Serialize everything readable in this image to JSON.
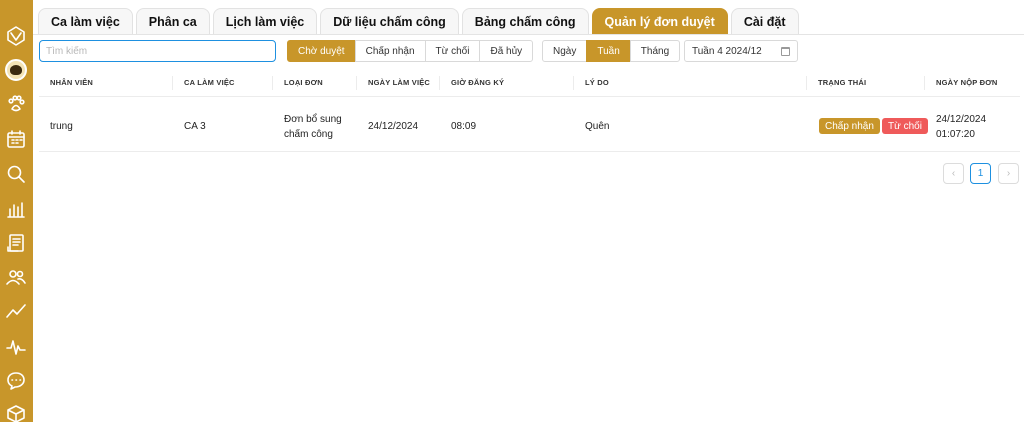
{
  "sidebar": {
    "icons": [
      "logo-icon",
      "paw-icon",
      "calendar-icon",
      "search-icon",
      "bar-chart-icon",
      "document-icon",
      "users-icon",
      "trend-icon",
      "pulse-icon",
      "chat-icon",
      "box-icon"
    ]
  },
  "tabs": [
    {
      "label": "Ca làm việc"
    },
    {
      "label": "Phân ca"
    },
    {
      "label": "Lịch làm việc"
    },
    {
      "label": "Dữ liệu chấm công"
    },
    {
      "label": "Bảng chấm công"
    },
    {
      "label": "Quản lý đơn duyệt",
      "active": true
    },
    {
      "label": "Cài đặt"
    }
  ],
  "search": {
    "placeholder": "Tìm kiếm",
    "value": ""
  },
  "status_filter": [
    "Chờ duyệt",
    "Chấp nhận",
    "Từ chối",
    "Đã hủy"
  ],
  "status_filter_active": "Chờ duyệt",
  "period_filter": [
    "Ngày",
    "Tuần",
    "Tháng"
  ],
  "period_filter_active": "Tuần",
  "week_picker": {
    "value": "Tuần 4 2024/12"
  },
  "table": {
    "columns": [
      "NHÂN VIÊN",
      "CA LÀM VIỆC",
      "LOẠI ĐƠN",
      "NGÀY LÀM VIỆC",
      "GIỜ ĐĂNG KÝ",
      "LÝ DO",
      "TRẠNG THÁI",
      "NGÀY NỘP ĐƠN"
    ],
    "rows": [
      {
        "employee": "trung",
        "shift": "CA 3",
        "type": "Đơn bổ sung chấm công",
        "work_date": "24/12/2024",
        "reg_time": "08:09",
        "reason": "Quên",
        "accept_label": "Chấp nhận",
        "reject_label": "Từ chối",
        "submitted": "24/12/2024 01:07:20"
      }
    ]
  },
  "pagination": {
    "prev": "‹",
    "current": "1",
    "next": "›"
  },
  "colors": {
    "accent": "#c8962a",
    "reject": "#ef5a5a",
    "link": "#1e90e0"
  }
}
